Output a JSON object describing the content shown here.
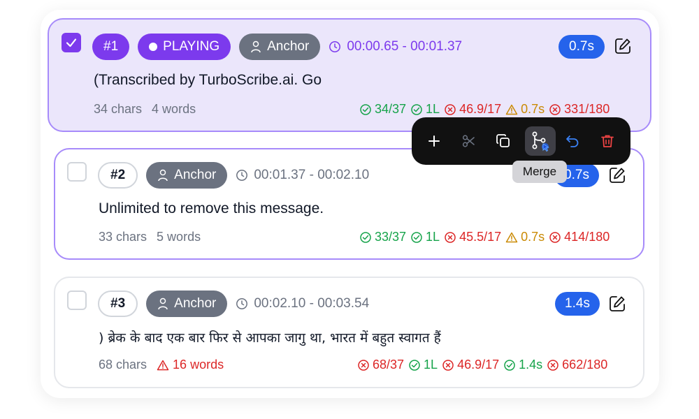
{
  "segments": [
    {
      "number": "#1",
      "status": "PLAYING",
      "speaker": "Anchor",
      "time_range": "00:00.65 - 00:01.37",
      "duration": "0.7s",
      "text": "(Transcribed by TurboScribe.ai. Go",
      "chars": "34 chars",
      "words": "4 words",
      "checked": true,
      "stats": [
        {
          "icon": "check-circle-icon",
          "value": "34/37",
          "level": "ok"
        },
        {
          "icon": "check-circle-icon",
          "value": "1L",
          "level": "ok"
        },
        {
          "icon": "x-circle-icon",
          "value": "46.9/17",
          "level": "bad"
        },
        {
          "icon": "warning-triangle-icon",
          "value": "0.7s",
          "level": "warn"
        },
        {
          "icon": "x-circle-icon",
          "value": "331/180",
          "level": "bad"
        }
      ]
    },
    {
      "number": "#2",
      "speaker": "Anchor",
      "time_range": "00:01.37 - 00:02.10",
      "duration": "0.7s",
      "text": "Unlimited to remove this message.",
      "chars": "33 chars",
      "words": "5 words",
      "checked": false,
      "stats": [
        {
          "icon": "check-circle-icon",
          "value": "33/37",
          "level": "ok"
        },
        {
          "icon": "check-circle-icon",
          "value": "1L",
          "level": "ok"
        },
        {
          "icon": "x-circle-icon",
          "value": "45.5/17",
          "level": "bad"
        },
        {
          "icon": "warning-triangle-icon",
          "value": "0.7s",
          "level": "warn"
        },
        {
          "icon": "x-circle-icon",
          "value": "414/180",
          "level": "bad"
        }
      ]
    },
    {
      "number": "#3",
      "speaker": "Anchor",
      "time_range": "00:02.10 - 00:03.54",
      "duration": "1.4s",
      "text": ") ब्रेक के बाद एक बार फिर से आपका जागु था, भारत में बहुत स्वागत हैं",
      "chars": "68 chars",
      "words": "16 words",
      "words_warning": true,
      "checked": false,
      "stats": [
        {
          "icon": "x-circle-icon",
          "value": "68/37",
          "level": "bad"
        },
        {
          "icon": "check-circle-icon",
          "value": "1L",
          "level": "ok"
        },
        {
          "icon": "x-circle-icon",
          "value": "46.9/17",
          "level": "bad"
        },
        {
          "icon": "check-circle-icon",
          "value": "1.4s",
          "level": "ok"
        },
        {
          "icon": "x-circle-icon",
          "value": "662/180",
          "level": "bad"
        }
      ]
    }
  ],
  "toolbar": {
    "buttons": [
      "plus-icon",
      "scissors-icon",
      "copy-icon",
      "merge-icon",
      "undo-icon",
      "trash-icon"
    ],
    "active": "merge-icon",
    "tooltip": "Merge"
  },
  "colors": {
    "accent": "#7c3aed",
    "duration_badge": "#2563eb",
    "ok": "#16a34a",
    "bad": "#dc2626",
    "warn": "#ca8a04"
  }
}
